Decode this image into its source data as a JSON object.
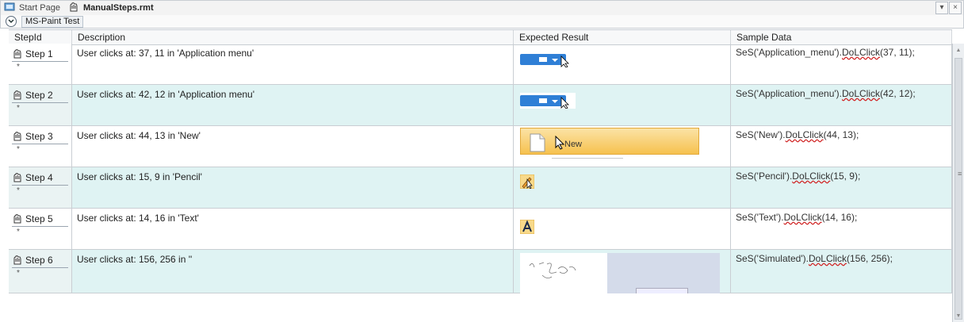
{
  "tabs": [
    {
      "label": "Start Page",
      "icon": "start-page-icon",
      "active": false
    },
    {
      "label": "ManualSteps.rmt",
      "icon": "manual-steps-icon",
      "active": true
    }
  ],
  "tab_controls": {
    "dropdown": "▾",
    "close": "×"
  },
  "group": {
    "caption": "MS-Paint Test"
  },
  "columns": [
    "StepId",
    "Description",
    "Expected Result",
    "Sample Data"
  ],
  "rows": [
    {
      "step": "Step 1",
      "marker": "*",
      "description": "User clicks at: 37, 11 in 'Application menu'",
      "sample_pre": "SeS('Application_menu').",
      "sample_fn": "DoLClick",
      "sample_post": "(37, 11);",
      "thumb": "application-menu-thumbnail"
    },
    {
      "step": "Step 2",
      "marker": "*",
      "description": "User clicks at: 42, 12 in 'Application menu'",
      "sample_pre": "SeS('Application_menu').",
      "sample_fn": "DoLClick",
      "sample_post": "(42, 12);",
      "thumb": "application-menu-thumbnail"
    },
    {
      "step": "Step 3",
      "marker": "*",
      "description": "User clicks at: 44, 13 in 'New'",
      "sample_pre": "SeS('New').",
      "sample_fn": "DoLClick",
      "sample_post": "(44, 13);",
      "thumb": "new-menu-item-thumbnail",
      "thumb_text": "New"
    },
    {
      "step": "Step 4",
      "marker": "*",
      "description": "User clicks at: 15, 9 in 'Pencil'",
      "sample_pre": "SeS('Pencil').",
      "sample_fn": "DoLClick",
      "sample_post": "(15, 9);",
      "thumb": "pencil-tool-thumbnail"
    },
    {
      "step": "Step 5",
      "marker": "*",
      "description": "User clicks at: 14, 16 in 'Text'",
      "sample_pre": "SeS('Text').",
      "sample_fn": "DoLClick",
      "sample_post": "(14, 16);",
      "thumb": "text-tool-thumbnail"
    },
    {
      "step": "Step 6",
      "marker": "*",
      "description": "User clicks at: 156, 256 in ''",
      "sample_pre": "SeS('Simulated').",
      "sample_fn": "DoLClick",
      "sample_post": "(156, 256);",
      "thumb": "canvas-thumbnail"
    }
  ],
  "colors": {
    "alt_row": "#dff3f3",
    "accent_blue": "#2f7fd6",
    "highlight_orange": "#f6c14e"
  }
}
